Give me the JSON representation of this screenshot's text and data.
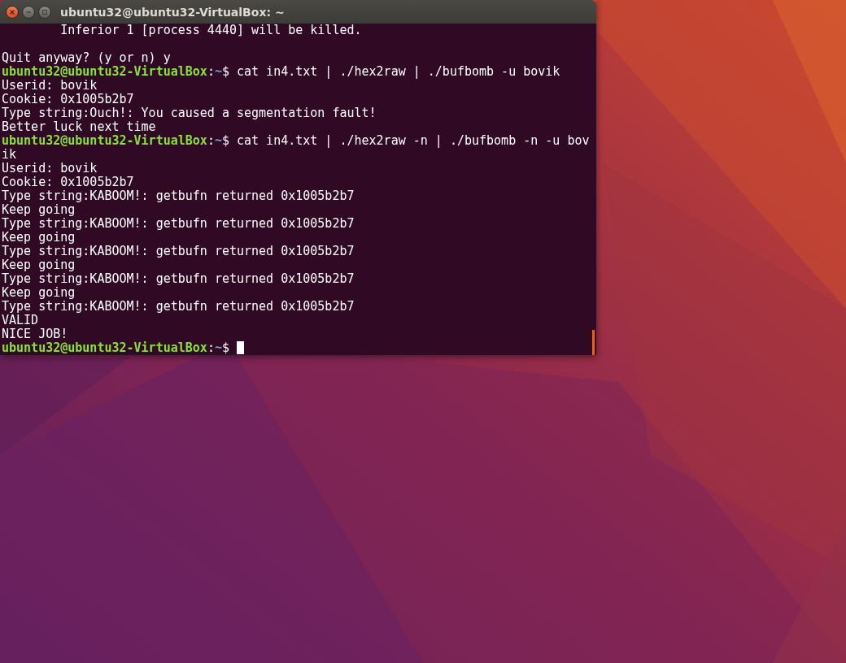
{
  "window": {
    "title": "ubuntu32@ubuntu32-VirtualBox: ~"
  },
  "terminal": {
    "lines": [
      {
        "kind": "output",
        "text": "        Inferior 1 [process 4440] will be killed."
      },
      {
        "kind": "blank"
      },
      {
        "kind": "output",
        "text": "Quit anyway? (y or n) y"
      },
      {
        "kind": "prompt",
        "user_host": "ubuntu32@ubuntu32-VirtualBox",
        "colon": ":",
        "path": "~",
        "symbol": "$",
        "command": "cat in4.txt | ./hex2raw | ./bufbomb -u bovik"
      },
      {
        "kind": "output",
        "text": "Userid: bovik"
      },
      {
        "kind": "output",
        "text": "Cookie: 0x1005b2b7"
      },
      {
        "kind": "output",
        "text": "Type string:Ouch!: You caused a segmentation fault!"
      },
      {
        "kind": "output",
        "text": "Better luck next time"
      },
      {
        "kind": "prompt",
        "user_host": "ubuntu32@ubuntu32-VirtualBox",
        "colon": ":",
        "path": "~",
        "symbol": "$",
        "command": "cat in4.txt | ./hex2raw -n | ./bufbomb -n -u bovik"
      },
      {
        "kind": "output",
        "text": "Userid: bovik"
      },
      {
        "kind": "output",
        "text": "Cookie: 0x1005b2b7"
      },
      {
        "kind": "output",
        "text": "Type string:KABOOM!: getbufn returned 0x1005b2b7"
      },
      {
        "kind": "output",
        "text": "Keep going"
      },
      {
        "kind": "output",
        "text": "Type string:KABOOM!: getbufn returned 0x1005b2b7"
      },
      {
        "kind": "output",
        "text": "Keep going"
      },
      {
        "kind": "output",
        "text": "Type string:KABOOM!: getbufn returned 0x1005b2b7"
      },
      {
        "kind": "output",
        "text": "Keep going"
      },
      {
        "kind": "output",
        "text": "Type string:KABOOM!: getbufn returned 0x1005b2b7"
      },
      {
        "kind": "output",
        "text": "Keep going"
      },
      {
        "kind": "output",
        "text": "Type string:KABOOM!: getbufn returned 0x1005b2b7"
      },
      {
        "kind": "output",
        "text": "VALID"
      },
      {
        "kind": "output",
        "text": "NICE JOB!"
      },
      {
        "kind": "prompt",
        "user_host": "ubuntu32@ubuntu32-VirtualBox",
        "colon": ":",
        "path": "~",
        "symbol": "$",
        "cursor": true
      }
    ]
  }
}
